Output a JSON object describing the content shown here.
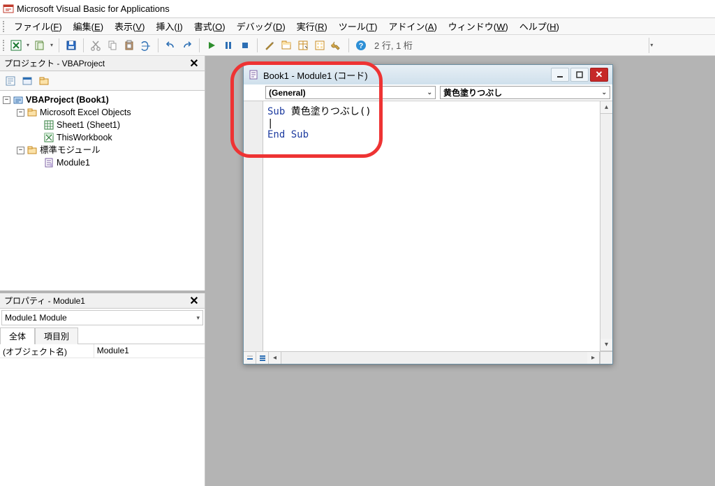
{
  "app": {
    "title": "Microsoft Visual Basic for Applications"
  },
  "menu": {
    "file": {
      "label": "ファイル",
      "u": "F"
    },
    "edit": {
      "label": "編集",
      "u": "E"
    },
    "view": {
      "label": "表示",
      "u": "V"
    },
    "insert": {
      "label": "挿入",
      "u": "I"
    },
    "format": {
      "label": "書式",
      "u": "O"
    },
    "debug": {
      "label": "デバッグ",
      "u": "D"
    },
    "run": {
      "label": "実行",
      "u": "R"
    },
    "tools": {
      "label": "ツール",
      "u": "T"
    },
    "addins": {
      "label": "アドイン",
      "u": "A"
    },
    "window": {
      "label": "ウィンドウ",
      "u": "W"
    },
    "help": {
      "label": "ヘルプ",
      "u": "H"
    }
  },
  "toolbar": {
    "status": "2 行, 1 桁"
  },
  "project": {
    "title": "プロジェクト - VBAProject",
    "root": "VBAProject (Book1)",
    "folder_excel": "Microsoft Excel Objects",
    "sheet1": "Sheet1 (Sheet1)",
    "thiswb": "ThisWorkbook",
    "folder_std": "標準モジュール",
    "module1": "Module1"
  },
  "properties": {
    "title": "プロパティ - Module1",
    "object_name_row": "Module1 Module",
    "tabs": {
      "zentai": "全体",
      "komoku": "項目別"
    },
    "rows": [
      {
        "name": "(オブジェクト名)",
        "value": "Module1"
      }
    ]
  },
  "codewin": {
    "title": "Book1 - Module1 (コード)",
    "selector_left": "(General)",
    "selector_right": "黄色塗りつぶし",
    "code_line1_kw": "Sub",
    "code_line1_rest": " 黄色塗りつぶし()",
    "code_line2": "",
    "code_line3_kw": "End Sub"
  }
}
